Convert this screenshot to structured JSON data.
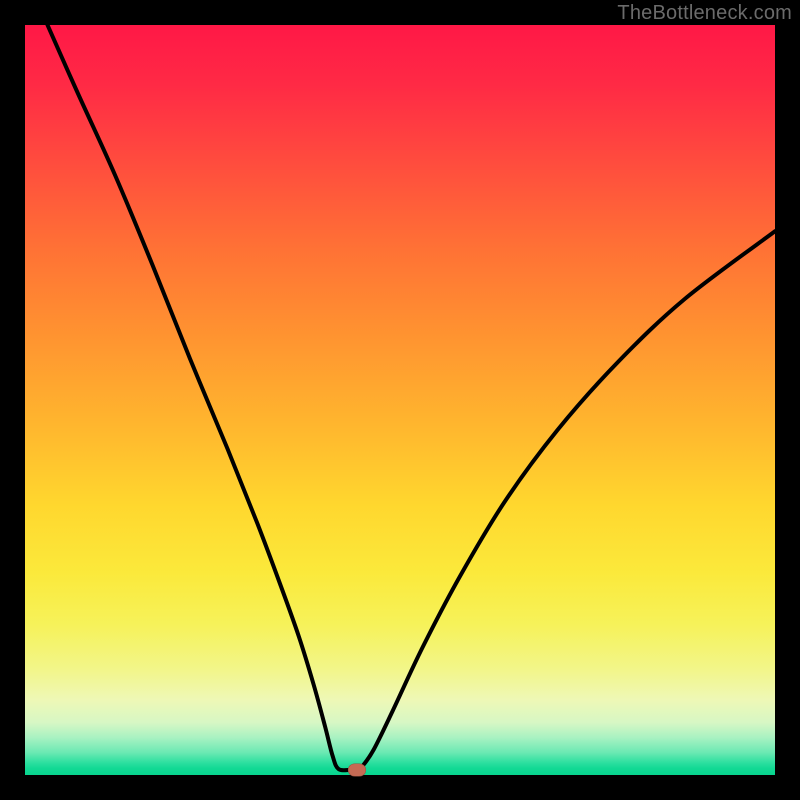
{
  "watermark": "TheBottleneck.com",
  "colors": {
    "frame_bg": "#000000",
    "gradient_top": "#ff1846",
    "gradient_bottom": "#07d58f",
    "curve": "#000000",
    "marker": "#c56a54",
    "watermark": "#6b6b6b"
  },
  "chart_data": {
    "type": "line",
    "title": "",
    "xlabel": "",
    "ylabel": "",
    "xlim": [
      0,
      100
    ],
    "ylim": [
      0,
      100
    ],
    "note": "No axis ticks or numeric labels are visible; values are estimated to reproduce the curve shape (x,y in percent of plot area, y=0 at bottom).",
    "series": [
      {
        "name": "bottleneck-curve",
        "points": [
          {
            "x": 3.0,
            "y": 100.0
          },
          {
            "x": 7.0,
            "y": 91.0
          },
          {
            "x": 12.0,
            "y": 80.0
          },
          {
            "x": 17.0,
            "y": 68.0
          },
          {
            "x": 22.0,
            "y": 55.5
          },
          {
            "x": 27.0,
            "y": 43.5
          },
          {
            "x": 31.0,
            "y": 33.5
          },
          {
            "x": 34.0,
            "y": 25.5
          },
          {
            "x": 36.5,
            "y": 18.5
          },
          {
            "x": 38.5,
            "y": 12.0
          },
          {
            "x": 40.0,
            "y": 6.5
          },
          {
            "x": 41.0,
            "y": 2.6
          },
          {
            "x": 41.8,
            "y": 0.8
          },
          {
            "x": 43.5,
            "y": 0.7
          },
          {
            "x": 44.2,
            "y": 0.7
          },
          {
            "x": 45.0,
            "y": 1.2
          },
          {
            "x": 46.5,
            "y": 3.4
          },
          {
            "x": 49.0,
            "y": 8.5
          },
          {
            "x": 53.0,
            "y": 17.0
          },
          {
            "x": 58.0,
            "y": 26.5
          },
          {
            "x": 64.0,
            "y": 36.5
          },
          {
            "x": 71.0,
            "y": 46.0
          },
          {
            "x": 79.0,
            "y": 55.0
          },
          {
            "x": 88.0,
            "y": 63.5
          },
          {
            "x": 100.0,
            "y": 72.5
          }
        ]
      }
    ],
    "marker": {
      "x": 44.3,
      "y": 0.7
    }
  }
}
